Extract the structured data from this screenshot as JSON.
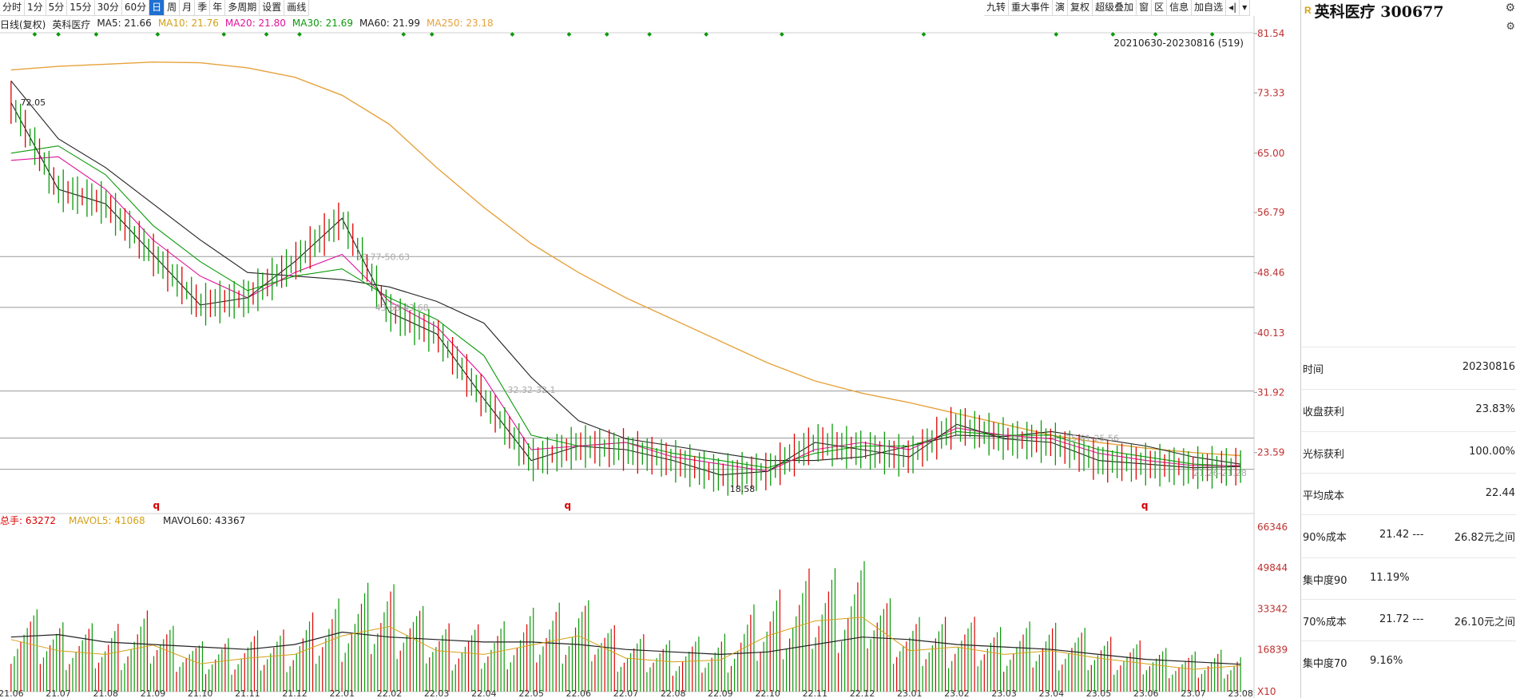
{
  "toolbar": {
    "left": [
      "分时",
      "1分",
      "5分",
      "15分",
      "30分",
      "60分",
      "日",
      "周",
      "月",
      "季",
      "年",
      "多周期",
      "设置",
      "画线"
    ],
    "active": "日",
    "right": [
      "九转",
      "重大事件",
      "演",
      "复权",
      "超级叠加",
      "窗",
      "区",
      "信息",
      "加自选",
      "◂|",
      "▾"
    ]
  },
  "legend": [
    {
      "text": "日线(复权)",
      "color": "#222222"
    },
    {
      "text": "英科医疗",
      "color": "#222222"
    },
    {
      "text": "MA5: 21.66",
      "color": "#222222"
    },
    {
      "text": "MA10: 21.76",
      "color": "#d4a017"
    },
    {
      "text": "MA20: 21.80",
      "color": "#e0119b"
    },
    {
      "text": "MA30: 21.69",
      "color": "#0a9a0a"
    },
    {
      "text": "MA60: 21.99",
      "color": "#222222"
    },
    {
      "text": "MA250: 23.18",
      "color": "#e6a23c"
    }
  ],
  "range_label": "20210630-20230816 (519)",
  "panel": {
    "badge": "R",
    "title": "英科医疗 300677",
    "rows": [
      {
        "label": "时间",
        "value": "20230816"
      },
      {
        "label": "收盘获利",
        "value": "23.83%"
      },
      {
        "label": "光标获利",
        "value": "100.00%"
      },
      {
        "label": "平均成本",
        "value": "22.44"
      },
      {
        "label": "90%成本",
        "value": "21.42 ---",
        "value2": "26.82元之间"
      },
      {
        "label": "集中度90",
        "value": "11.19%"
      },
      {
        "label": "70%成本",
        "value": "21.72 ---",
        "value2": "26.10元之间"
      },
      {
        "label": "集中度70",
        "value": "9.16%"
      }
    ]
  },
  "chart_data": [
    {
      "type": "line",
      "title": "",
      "ylim": [
        15.5,
        81.54
      ],
      "y_ticks": [
        "81.54",
        "73.33",
        "65.00",
        "56.79",
        "48.46",
        "40.13",
        "31.92",
        "23.59"
      ],
      "x_ticks": [
        "21.06",
        "21.07",
        "21.08",
        "21.09",
        "21.10",
        "21.11",
        "21.12",
        "22.01",
        "22.02",
        "22.03",
        "22.04",
        "22.05",
        "22.06",
        "22.07",
        "22.08",
        "22.09",
        "22.10",
        "22.11",
        "22.12",
        "23.01",
        "23.02",
        "23.03",
        "23.04",
        "23.05",
        "23.06",
        "23.07",
        "23.08"
      ],
      "x_index": [
        0,
        1,
        2,
        3,
        4,
        5,
        6,
        7,
        8,
        9,
        10,
        11,
        12,
        13,
        14,
        15,
        16,
        17,
        18,
        19,
        20,
        21,
        22,
        23,
        24,
        25,
        26
      ],
      "series": [
        {
          "name": "MA250",
          "color": "#e6a23c",
          "x": [
            0,
            1,
            2,
            3,
            4,
            5,
            6,
            7,
            8,
            9,
            10,
            11,
            12,
            13,
            14,
            15,
            16,
            17,
            18,
            19,
            20,
            21,
            22,
            23,
            24,
            25,
            26
          ],
          "values": [
            76.5,
            77.0,
            77.3,
            77.6,
            77.5,
            76.8,
            75.5,
            73.0,
            69.0,
            63.0,
            57.5,
            52.5,
            48.5,
            45.0,
            42.0,
            39.0,
            36.0,
            33.5,
            31.8,
            30.5,
            29.0,
            27.5,
            26.0,
            25.0,
            24.2,
            23.6,
            23.18
          ]
        },
        {
          "name": "MA60",
          "color": "#222222",
          "x": [
            0,
            1,
            2,
            3,
            4,
            5,
            6,
            7,
            8,
            9,
            10,
            11,
            12,
            13,
            14,
            15,
            16,
            17,
            18,
            19,
            20,
            21,
            22,
            23,
            24,
            25,
            26
          ],
          "values": [
            75.0,
            67.0,
            63.0,
            58.0,
            53.0,
            48.5,
            48.0,
            47.5,
            46.5,
            44.5,
            41.5,
            34.0,
            28.0,
            25.5,
            24.5,
            23.5,
            22.5,
            22.5,
            23.0,
            24.5,
            26.0,
            25.8,
            26.5,
            25.5,
            24.5,
            23.0,
            21.99
          ]
        },
        {
          "name": "MA30",
          "color": "#0a9a0a",
          "x": [
            0,
            1,
            2,
            3,
            4,
            5,
            6,
            7,
            8,
            9,
            10,
            11,
            12,
            13,
            14,
            15,
            16,
            17,
            18,
            19,
            20,
            21,
            22,
            23,
            24,
            25,
            26
          ],
          "values": [
            65.0,
            66.0,
            62.0,
            55.0,
            50.0,
            46.0,
            48.0,
            49.0,
            45.0,
            42.0,
            37.0,
            26.0,
            24.5,
            25.0,
            23.5,
            22.5,
            21.5,
            23.5,
            24.5,
            24.5,
            26.5,
            26.0,
            26.0,
            24.0,
            23.0,
            22.0,
            21.69
          ]
        },
        {
          "name": "MA20",
          "color": "#e0119b",
          "x": [
            0,
            1,
            2,
            3,
            4,
            5,
            6,
            7,
            8,
            9,
            10,
            11,
            12,
            13,
            14,
            15,
            16,
            17,
            18,
            19,
            20,
            21,
            22,
            23,
            24,
            25,
            26
          ],
          "values": [
            64.0,
            64.5,
            60.0,
            53.0,
            48.0,
            45.0,
            48.5,
            51.0,
            44.5,
            41.0,
            34.0,
            24.0,
            24.5,
            25.0,
            23.0,
            22.0,
            21.0,
            24.0,
            25.0,
            24.0,
            27.0,
            26.0,
            25.5,
            23.5,
            22.5,
            21.8,
            21.8
          ]
        },
        {
          "name": "MA5",
          "color": "#222222",
          "x": [
            0,
            1,
            2,
            3,
            4,
            5,
            6,
            7,
            8,
            9,
            10,
            11,
            12,
            13,
            14,
            15,
            16,
            17,
            18,
            19,
            20,
            21,
            22,
            23,
            24,
            25,
            26
          ],
          "values": [
            72.0,
            60.0,
            58.0,
            51.0,
            44.0,
            45.0,
            50.0,
            56.0,
            43.0,
            40.0,
            31.0,
            22.5,
            24.5,
            24.0,
            22.5,
            20.5,
            21.0,
            25.0,
            24.0,
            23.0,
            27.5,
            25.5,
            25.0,
            22.5,
            22.0,
            21.5,
            21.66
          ]
        }
      ],
      "annotations": [
        {
          "text": "72.05",
          "x": 0.2,
          "y": 72.05
        },
        {
          "text": "18.58",
          "x": 15.2,
          "y": 18.58
        },
        {
          "text": "50.77-50.63",
          "x": 7.3,
          "y": 50.7
        },
        {
          "text": "43.68-43.68",
          "x": 7.7,
          "y": 43.68
        },
        {
          "text": "32.32-32.1",
          "x": 10.5,
          "y": 32.3
        },
        {
          "text": "25.61-25.56",
          "x": 22.3,
          "y": 25.6
        },
        {
          "text": "21.26-21.28",
          "x": 25.0,
          "y": 20.8
        }
      ],
      "h_levels": [
        50.7,
        43.68,
        32.1,
        25.6,
        21.28
      ],
      "q_markers": [
        {
          "text": "q",
          "x": 3.0
        },
        {
          "text": "q",
          "x": 11.7
        },
        {
          "text": "q",
          "x": 23.9
        }
      ]
    },
    {
      "type": "bar",
      "title": "",
      "legend": [
        {
          "text": "总手: 63272",
          "color": "#e00000"
        },
        {
          "text": "MAVOL5: 41068",
          "color": "#d4a017"
        },
        {
          "text": "MAVOL60: 43367",
          "color": "#222222"
        }
      ],
      "ylim": [
        0,
        66346
      ],
      "y_ticks": [
        "66346",
        "49844",
        "33342",
        "16839",
        "X10"
      ],
      "volume": [
        28000,
        22000,
        20000,
        25000,
        15000,
        18000,
        20000,
        30000,
        35000,
        22000,
        20000,
        25000,
        30000,
        18000,
        16000,
        17000,
        30000,
        38000,
        40000,
        22000,
        24000,
        20000,
        22000,
        18000,
        15000,
        12000,
        14000
      ],
      "mavol60": [
        22000,
        23000,
        20000,
        19000,
        18000,
        17000,
        19000,
        24000,
        22000,
        21000,
        20000,
        20000,
        19000,
        17000,
        16000,
        15000,
        16000,
        19000,
        22000,
        21000,
        19000,
        18000,
        17000,
        15000,
        13000,
        12000,
        11000
      ]
    }
  ]
}
